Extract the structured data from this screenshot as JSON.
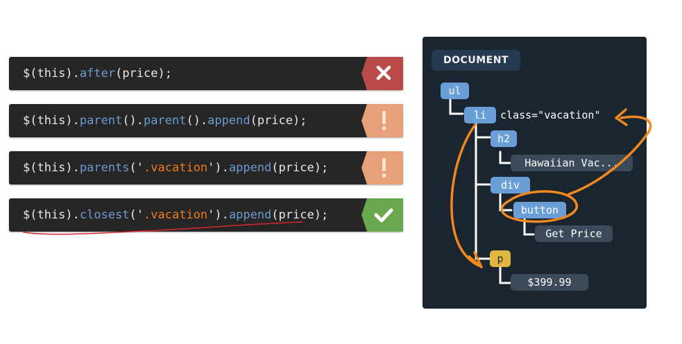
{
  "code_lines": [
    {
      "parts": [
        {
          "text": "$(this).",
          "kind": "plain"
        },
        {
          "text": "after",
          "kind": "method"
        },
        {
          "text": "(price);",
          "kind": "plain"
        }
      ],
      "status": "wrong",
      "status_icon": "x-icon",
      "status_color": "#b94a48"
    },
    {
      "parts": [
        {
          "text": "$(this).",
          "kind": "plain"
        },
        {
          "text": "parent",
          "kind": "method"
        },
        {
          "text": "().",
          "kind": "plain"
        },
        {
          "text": "parent",
          "kind": "method"
        },
        {
          "text": "().",
          "kind": "plain"
        },
        {
          "text": "append",
          "kind": "method"
        },
        {
          "text": "(price);",
          "kind": "plain"
        }
      ],
      "status": "warning",
      "status_icon": "exclamation-icon",
      "status_color": "#e8a07a"
    },
    {
      "parts": [
        {
          "text": "$(this).",
          "kind": "plain"
        },
        {
          "text": "parents",
          "kind": "method"
        },
        {
          "text": "('",
          "kind": "plain"
        },
        {
          "text": ".vacation",
          "kind": "string"
        },
        {
          "text": "').",
          "kind": "plain"
        },
        {
          "text": "append",
          "kind": "method"
        },
        {
          "text": "(price);",
          "kind": "plain"
        }
      ],
      "status": "warning",
      "status_icon": "exclamation-icon",
      "status_color": "#e8a07a"
    },
    {
      "parts": [
        {
          "text": "$(this).",
          "kind": "plain"
        },
        {
          "text": "closest",
          "kind": "method"
        },
        {
          "text": "('",
          "kind": "plain"
        },
        {
          "text": ".vacation",
          "kind": "string"
        },
        {
          "text": "').",
          "kind": "plain"
        },
        {
          "text": "append",
          "kind": "method"
        },
        {
          "text": "(price);",
          "kind": "plain"
        }
      ],
      "status": "correct",
      "status_icon": "checkmark-icon",
      "status_color": "#6aa84f"
    }
  ],
  "dom_tree": {
    "label": "DOCUMENT",
    "nodes": {
      "ul": "ul",
      "li": "li",
      "li_attr": "class=\"vacation\"",
      "h2": "h2",
      "h2_text": "Hawaiian Vac...",
      "div": "div",
      "button": "button",
      "button_text": "Get Price",
      "p": "p",
      "p_text": "$399.99"
    }
  },
  "colors": {
    "method": "#6d9bd2",
    "string": "#f07d1d",
    "annotation_orange": "#f08a1e",
    "underline_red": "#d9282b",
    "tag_blue": "#6a9ed7",
    "tag_yellow": "#e0b83f",
    "panel_bg": "#1b2530"
  }
}
